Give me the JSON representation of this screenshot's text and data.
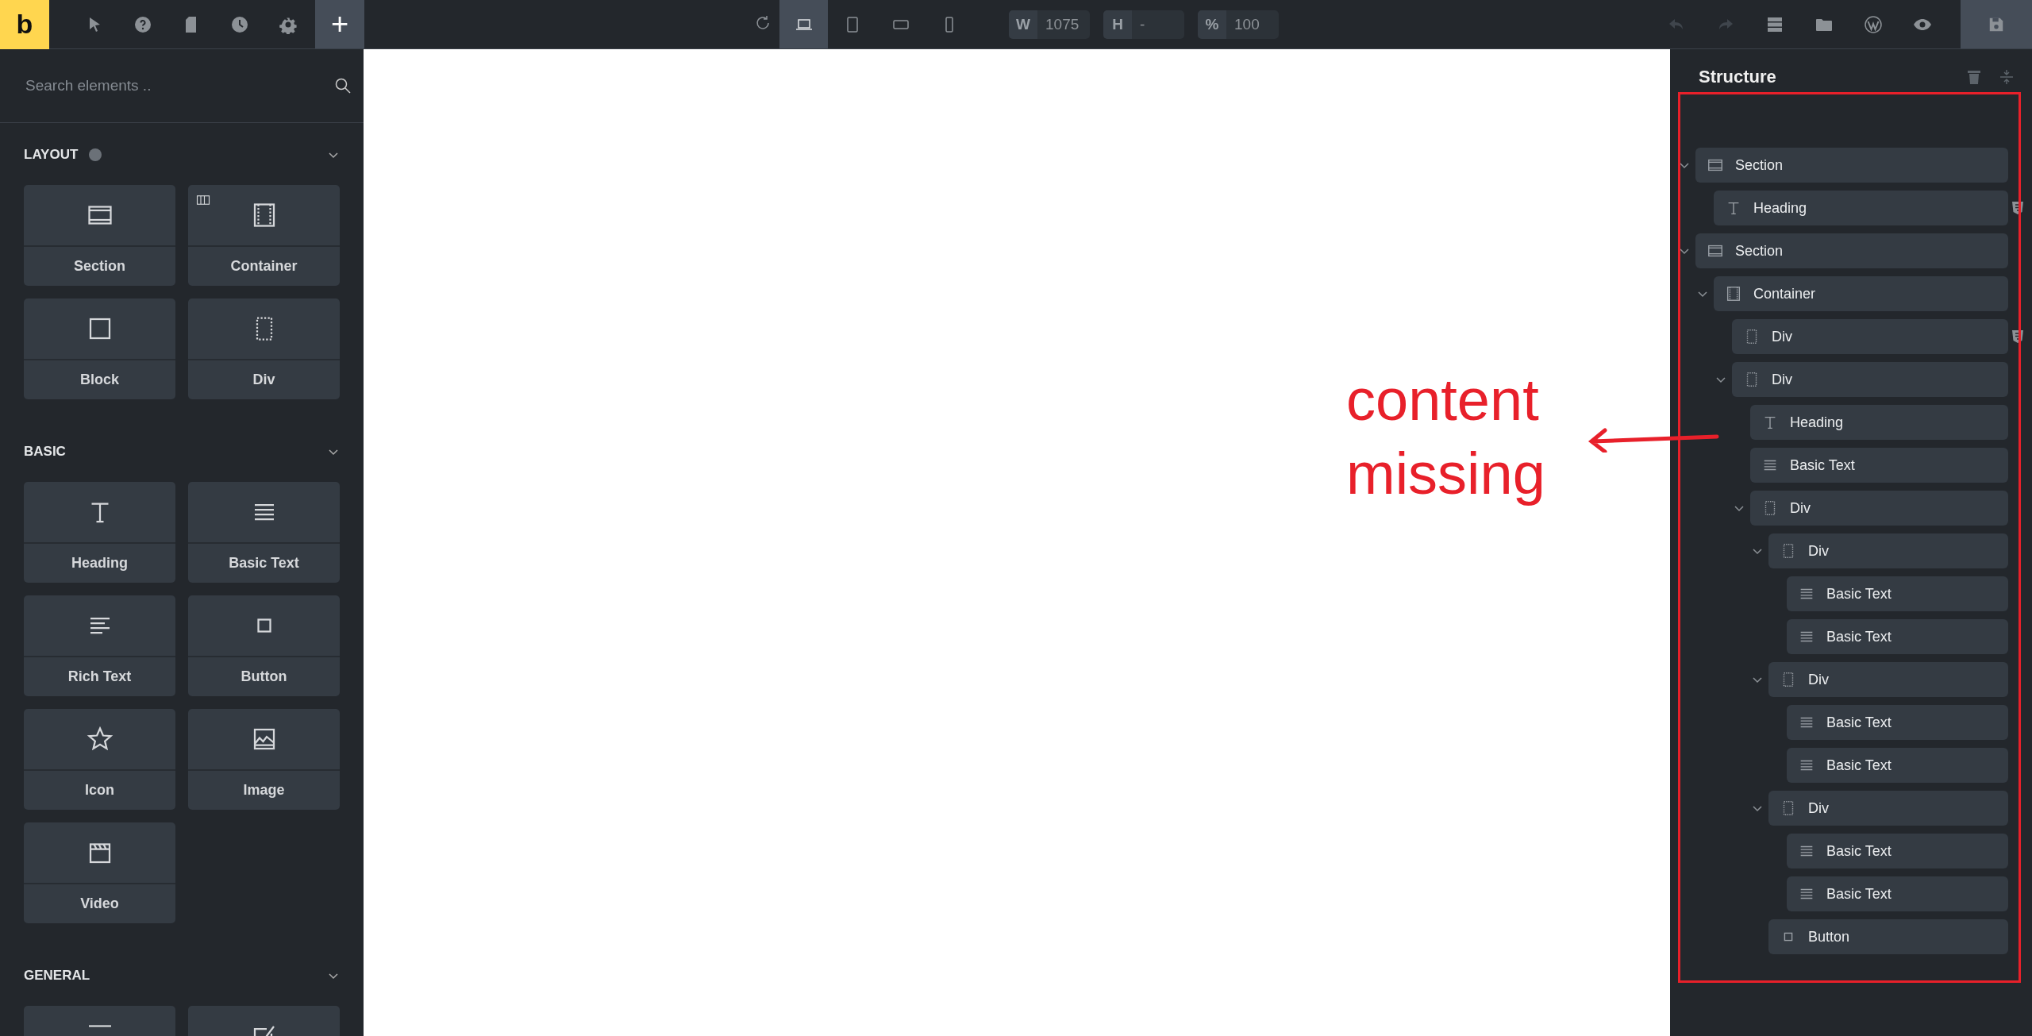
{
  "topbar": {
    "logo": "b",
    "left_tools": [
      {
        "kind": "pointer"
      },
      {
        "kind": "help"
      },
      {
        "kind": "page"
      },
      {
        "kind": "history"
      },
      {
        "kind": "settings"
      }
    ],
    "add_button": {
      "label": "+",
      "selected": true
    },
    "devices": [
      {
        "kind": "desktop",
        "selected": true
      },
      {
        "kind": "tablet",
        "selected": false
      },
      {
        "kind": "landscape",
        "selected": false
      },
      {
        "kind": "phone",
        "selected": false
      }
    ],
    "fields": [
      {
        "label": "W",
        "value": "1075"
      },
      {
        "label": "H",
        "value": "-"
      },
      {
        "label": "%",
        "value": "100"
      }
    ],
    "actions": [
      {
        "kind": "undo",
        "disabled": true
      },
      {
        "kind": "redo",
        "disabled": true
      },
      {
        "kind": "layers",
        "disabled": false
      },
      {
        "kind": "folder",
        "disabled": false
      },
      {
        "kind": "wordpress",
        "disabled": false
      },
      {
        "kind": "eye",
        "disabled": false
      }
    ]
  },
  "elements_panel": {
    "search": {
      "placeholder": "Search elements .."
    },
    "categories": [
      {
        "title": "LAYOUT",
        "info": true,
        "expanded": true,
        "elements": [
          {
            "label": "Section",
            "kind": "section"
          },
          {
            "label": "Container",
            "kind": "container"
          },
          {
            "label": "Block",
            "kind": "block"
          },
          {
            "label": "Div",
            "kind": "div"
          }
        ]
      },
      {
        "title": "BASIC",
        "info": false,
        "expanded": true,
        "elements": [
          {
            "label": "Heading",
            "kind": "heading"
          },
          {
            "label": "Basic Text",
            "kind": "text"
          },
          {
            "label": "Rich Text",
            "kind": "richtext"
          },
          {
            "label": "Button",
            "kind": "button"
          },
          {
            "label": "Icon",
            "kind": "star"
          },
          {
            "label": "Image",
            "kind": "image"
          },
          {
            "label": "Video",
            "kind": "video"
          }
        ]
      },
      {
        "title": "GENERAL",
        "info": false,
        "expanded": true,
        "elements": [
          {
            "kind": "divider"
          },
          {
            "kind": "checkbox"
          }
        ]
      }
    ]
  },
  "structure_panel": {
    "title": "Structure",
    "tree": [
      {
        "label": "Section",
        "kind": "section",
        "expanded": true,
        "flagged": false,
        "children": [
          {
            "label": "Heading",
            "kind": "heading",
            "flagged": true
          }
        ]
      },
      {
        "label": "Section",
        "kind": "section",
        "expanded": true,
        "flagged": false,
        "children": [
          {
            "label": "Container",
            "kind": "container",
            "expanded": true,
            "flagged": false,
            "children": [
              {
                "label": "Div",
                "kind": "div",
                "flagged": true
              },
              {
                "label": "Div",
                "kind": "div",
                "expanded": true,
                "flagged": false,
                "children": [
                  {
                    "label": "Heading",
                    "kind": "heading",
                    "flagged": false
                  },
                  {
                    "label": "Basic Text",
                    "kind": "text",
                    "flagged": false
                  },
                  {
                    "label": "Div",
                    "kind": "div",
                    "expanded": true,
                    "flagged": false,
                    "children": [
                      {
                        "label": "Div",
                        "kind": "div",
                        "expanded": true,
                        "flagged": false,
                        "children": [
                          {
                            "label": "Basic Text",
                            "kind": "text",
                            "flagged": false
                          },
                          {
                            "label": "Basic Text",
                            "kind": "text",
                            "flagged": false
                          }
                        ]
                      },
                      {
                        "label": "Div",
                        "kind": "div",
                        "expanded": true,
                        "flagged": false,
                        "children": [
                          {
                            "label": "Basic Text",
                            "kind": "text",
                            "flagged": false
                          },
                          {
                            "label": "Basic Text",
                            "kind": "text",
                            "flagged": false
                          }
                        ]
                      },
                      {
                        "label": "Div",
                        "kind": "div",
                        "expanded": true,
                        "flagged": false,
                        "children": [
                          {
                            "label": "Basic Text",
                            "kind": "text",
                            "flagged": false
                          },
                          {
                            "label": "Basic Text",
                            "kind": "text",
                            "flagged": false
                          }
                        ]
                      },
                      {
                        "label": "Button",
                        "kind": "button",
                        "flagged": false
                      }
                    ]
                  }
                ]
              }
            ]
          }
        ]
      }
    ]
  },
  "annotation": {
    "text": "content missing"
  }
}
